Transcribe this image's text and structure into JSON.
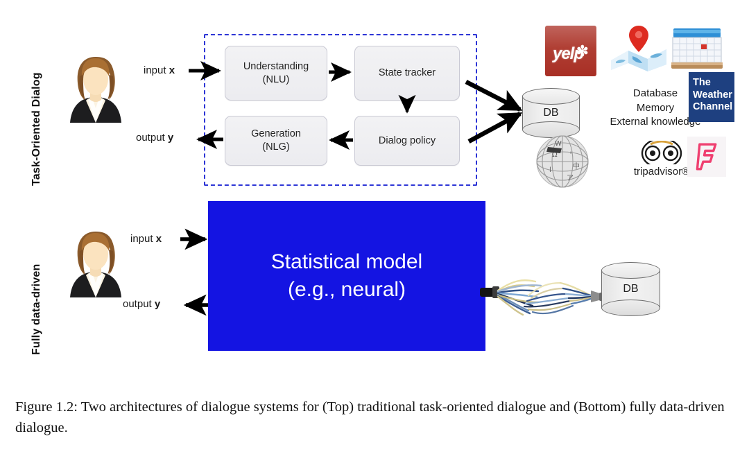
{
  "figure": {
    "caption": "Figure 1.2: Two architectures of dialogue systems for (Top) traditional task-oriented dialogue and (Bottom) fully data-driven dialogue."
  },
  "rows": {
    "top": {
      "side_label": "Task-Oriented Dialog",
      "input_label_prefix": "input ",
      "input_label_var": "x",
      "output_label_prefix": "output ",
      "output_label_var": "y",
      "modules": [
        {
          "id": "nlu",
          "line1": "Understanding",
          "line2": "(NLU)"
        },
        {
          "id": "state",
          "line1": "State tracker",
          "line2": ""
        },
        {
          "id": "nlg",
          "line1": "Generation",
          "line2": "(NLG)"
        },
        {
          "id": "policy",
          "line1": "Dialog policy",
          "line2": ""
        }
      ],
      "db_label": "DB",
      "knowledge_lines": [
        "Database",
        "Memory",
        "External knowledge"
      ],
      "logos": [
        {
          "id": "yelp",
          "name": "yelp-logo",
          "text": "yelp"
        },
        {
          "id": "maps",
          "name": "map-icon",
          "text": ""
        },
        {
          "id": "calendar",
          "name": "calendar-icon",
          "text": ""
        },
        {
          "id": "weather",
          "name": "the-weather-channel-logo",
          "line1": "The",
          "line2": "Weather",
          "line3": "Channel"
        },
        {
          "id": "wikipedia",
          "name": "wikipedia-globe-logo",
          "text": ""
        },
        {
          "id": "tripadvisor",
          "name": "tripadvisor-logo",
          "text": "tripadvisor®"
        },
        {
          "id": "foursquare",
          "name": "foursquare-logo",
          "text": ""
        }
      ]
    },
    "bottom": {
      "side_label": "Fully data-driven",
      "input_label_prefix": "input ",
      "input_label_var": "x",
      "output_label_prefix": "output ",
      "output_label_var": "y",
      "model_line1": "Statistical model",
      "model_line2": "(e.g., neural)",
      "db_label": "DB"
    }
  },
  "colors": {
    "dashed_border": "#2d35d6",
    "model_box": "#1414e2",
    "model_text": "#ffffff",
    "module_fill": "#ececf0",
    "arrow": "#000000",
    "yelp_red": "#a82f25",
    "weather_navy": "#1e4080",
    "foursquare_pink": "#ef3f70"
  }
}
